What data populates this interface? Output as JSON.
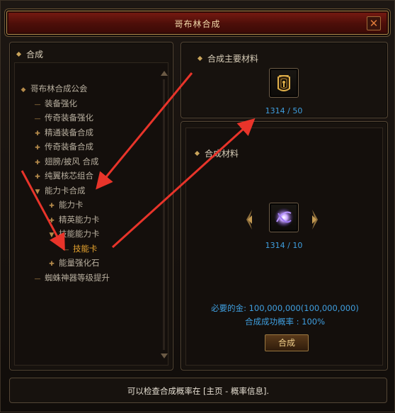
{
  "window": {
    "title": "哥布林合成",
    "close_glyph": "✕"
  },
  "left_panel": {
    "header": "合成",
    "tree": [
      {
        "label": "哥布林合成公会",
        "mark": "◆"
      },
      {
        "label": "装备强化",
        "mark": "—"
      },
      {
        "label": "传奇装备强化",
        "mark": "—"
      },
      {
        "label": "精通装备合成",
        "mark": "✚"
      },
      {
        "label": "传奇装备合成",
        "mark": "✚"
      },
      {
        "label": "翅膀/披风 合成",
        "mark": "✚"
      },
      {
        "label": "纯翼核芯组合",
        "mark": "✚"
      },
      {
        "label": "能力卡合成",
        "mark": "▼"
      },
      {
        "label": "能力卡",
        "mark": "✚"
      },
      {
        "label": "精英能力卡",
        "mark": "✚"
      },
      {
        "label": "技能能力卡",
        "mark": "▼"
      },
      {
        "label": "技能卡",
        "mark": "—",
        "selected": true
      },
      {
        "label": "能量强化石",
        "mark": "✚"
      },
      {
        "label": "蜘蛛神器等级提升",
        "mark": "—"
      }
    ]
  },
  "main_material": {
    "header": "合成主要材料",
    "count": "1314 / 50",
    "icon": "gold-emblem-icon"
  },
  "material": {
    "header": "合成材料",
    "count": "1314 / 10",
    "icon": "purple-crystal-icon"
  },
  "cost": {
    "gold_label": "必要的金: 100,000,000(100,000,000)",
    "success_rate": "合成成功概率 : 100%"
  },
  "craft_button": "合成",
  "footer": {
    "text": "可以检查合成概率在 [主页 - 概率信息]."
  },
  "colors": {
    "accent_blue": "#3f9fe0",
    "selected_orange": "#e6a32e",
    "annotation_red": "#e8342a"
  }
}
